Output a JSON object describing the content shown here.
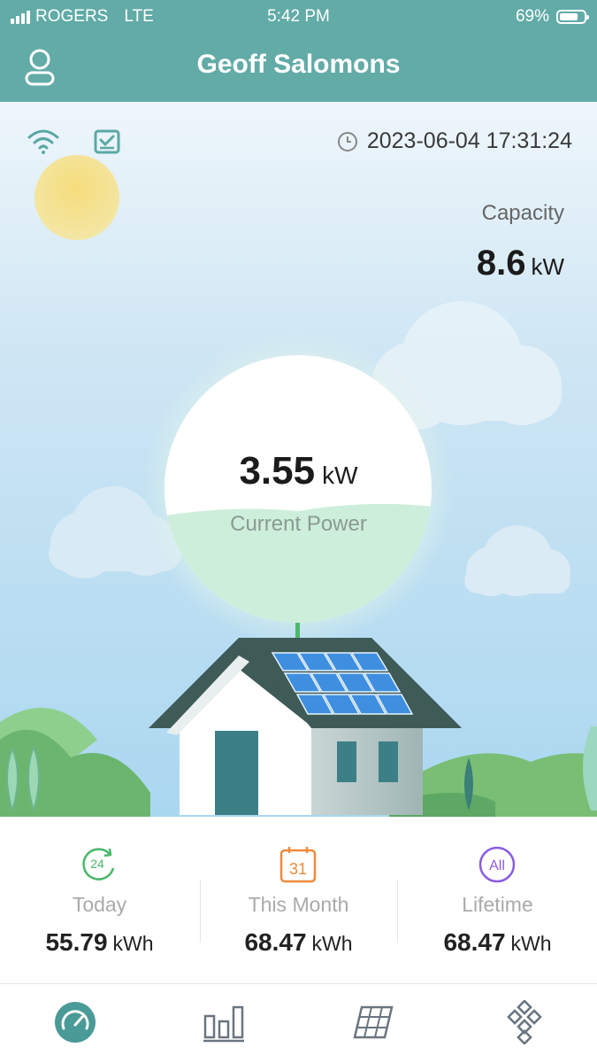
{
  "status_bar": {
    "carrier": "ROGERS",
    "network": "LTE",
    "time": "5:42 PM",
    "battery": "69%"
  },
  "header": {
    "title": "Geoff Salomons"
  },
  "station": {
    "timestamp": "2023-06-04 17:31:24",
    "capacity_label": "Capacity",
    "capacity_value": "8.6",
    "capacity_unit": "kW",
    "current_power_value": "3.55",
    "current_power_unit": "kW",
    "current_power_label": "Current Power"
  },
  "stats": [
    {
      "label": "Today",
      "value": "55.79",
      "unit": "kWh",
      "icon_text": "24",
      "icon": "24h-refresh-icon"
    },
    {
      "label": "This Month",
      "value": "68.47",
      "unit": "kWh",
      "icon_text": "31",
      "icon": "calendar-icon"
    },
    {
      "label": "Lifetime",
      "value": "68.47",
      "unit": "kWh",
      "icon_text": "All",
      "icon": "all-circle-icon"
    }
  ],
  "tabs": [
    {
      "name": "overview",
      "icon": "gauge-icon",
      "active": true
    },
    {
      "name": "statistics",
      "icon": "bar-chart-icon",
      "active": false
    },
    {
      "name": "panels",
      "icon": "solar-panel-icon",
      "active": false
    },
    {
      "name": "devices",
      "icon": "grid-diamond-icon",
      "active": false
    }
  ],
  "colors": {
    "brand": "#62aba7",
    "active_tab": "#4a9a97",
    "today_icon": "#4bb86a",
    "month_icon": "#ef8a3c",
    "lifetime_icon": "#8a5ce0"
  }
}
